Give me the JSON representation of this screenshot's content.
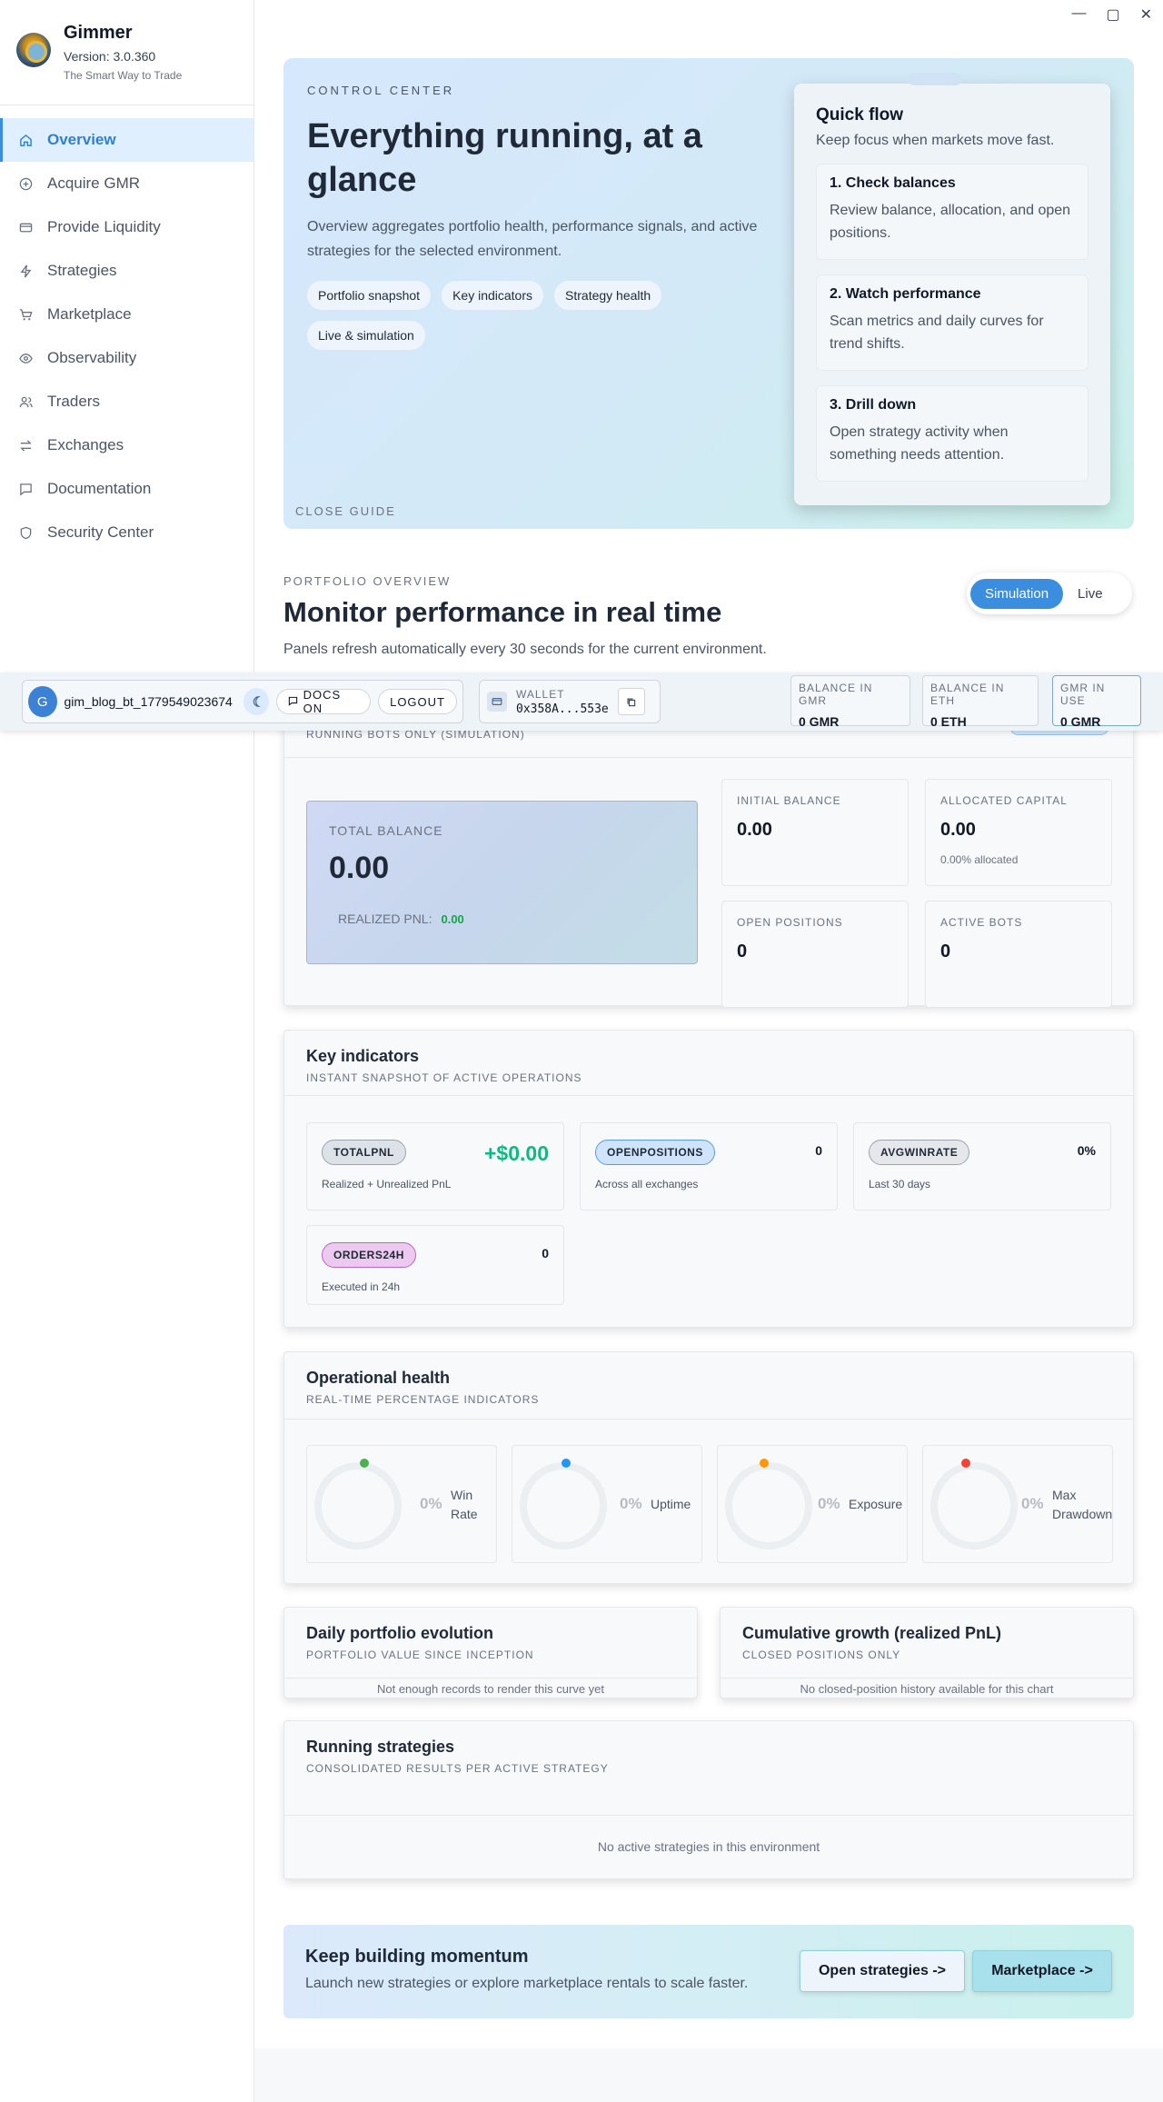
{
  "app": {
    "name": "Gimmer",
    "version": "Version: 3.0.360",
    "tagline": "The Smart Way to Trade"
  },
  "window_controls": {
    "minimize": "—",
    "maximize": "▢",
    "close": "✕"
  },
  "sidebar": {
    "items": [
      {
        "label": "Overview",
        "icon": "home-icon"
      },
      {
        "label": "Acquire GMR",
        "icon": "plus-circle-icon"
      },
      {
        "label": "Provide Liquidity",
        "icon": "card-icon"
      },
      {
        "label": "Strategies",
        "icon": "bolt-icon"
      },
      {
        "label": "Marketplace",
        "icon": "cart-icon"
      },
      {
        "label": "Observability",
        "icon": "eye-icon"
      },
      {
        "label": "Traders",
        "icon": "users-icon"
      },
      {
        "label": "Exchanges",
        "icon": "swap-icon"
      },
      {
        "label": "Documentation",
        "icon": "book-icon"
      },
      {
        "label": "Security Center",
        "icon": "shield-icon"
      }
    ]
  },
  "hero": {
    "kicker": "CONTROL CENTER",
    "title": "Everything running, at a glance",
    "description": "Overview aggregates portfolio health, performance signals, and active strategies for the selected environment.",
    "chips": [
      "Portfolio snapshot",
      "Key indicators",
      "Strategy health",
      "Live & simulation"
    ],
    "close_guide": "CLOSE GUIDE",
    "quick_flow": {
      "title": "Quick flow",
      "subtitle": "Keep focus when markets move fast.",
      "steps": [
        {
          "title": "1. Check balances",
          "text": "Review balance, allocation, and open positions."
        },
        {
          "title": "2. Watch performance",
          "text": "Scan metrics and daily curves for trend shifts."
        },
        {
          "title": "3. Drill down",
          "text": "Open strategy activity when something needs attention."
        }
      ]
    }
  },
  "portfolio_overview": {
    "kicker": "PORTFOLIO OVERVIEW",
    "title": "Monitor performance in real time",
    "description": "Panels refresh automatically every 30 seconds for the current environment.",
    "env_toggle": {
      "simulation": "Simulation",
      "live": "Live",
      "selected": "Simulation"
    }
  },
  "topbar": {
    "avatar_initial": "G",
    "username": "gim_blog_bt_1779549023674",
    "docs_label": "DOCS ON",
    "logout_label": "LOGOUT",
    "wallet_label": "WALLET",
    "wallet_address": "0x358A...553e",
    "balances": [
      {
        "label": "BALANCE IN GMR",
        "value": "0 GMR"
      },
      {
        "label": "BALANCE IN ETH",
        "value": "0 ETH"
      },
      {
        "label": "GMR IN USE",
        "value": "0 GMR"
      }
    ]
  },
  "balance_card": {
    "subtitle": "RUNNING BOTS ONLY (SIMULATION)",
    "total_label": "TOTAL BALANCE",
    "total_value": "0.00",
    "realized_label": "REALIZED PNL:",
    "realized_value": "0.00",
    "tiles": [
      {
        "label": "INITIAL BALANCE",
        "value": "0.00",
        "sub": ""
      },
      {
        "label": "ALLOCATED CAPITAL",
        "value": "0.00",
        "sub": "0.00% allocated"
      },
      {
        "label": "OPEN POSITIONS",
        "value": "0",
        "sub": ""
      },
      {
        "label": "ACTIVE BOTS",
        "value": "0",
        "sub": ""
      }
    ]
  },
  "key_indicators": {
    "title": "Key indicators",
    "subtitle": "INSTANT SNAPSHOT OF ACTIVE OPERATIONS",
    "items": [
      {
        "tag": "TOTALPNL",
        "value": "+$0.00",
        "desc": "Realized + Unrealized PnL",
        "color": "#dde2e8"
      },
      {
        "tag": "OPENPOSITIONS",
        "value": "0",
        "desc": "Across all exchanges",
        "color": "#cfe4fb"
      },
      {
        "tag": "AVGWINRATE",
        "value": "0%",
        "desc": "Last 30 days",
        "color": "#e5e7eb"
      },
      {
        "tag": "ORDERS24H",
        "value": "0",
        "desc": "Executed in 24h",
        "color": "#ecc9ee"
      }
    ]
  },
  "operational_health": {
    "title": "Operational health",
    "subtitle": "REAL-TIME PERCENTAGE INDICATORS",
    "gauges": [
      {
        "label": "Win Rate",
        "value": "0%",
        "color": "#4caf50"
      },
      {
        "label": "Uptime",
        "value": "0%",
        "color": "#2196f3"
      },
      {
        "label": "Exposure",
        "value": "0%",
        "color": "#ff9800"
      },
      {
        "label": "Max Drawdown",
        "value": "0%",
        "color": "#f44336"
      }
    ]
  },
  "daily_portfolio": {
    "title": "Daily portfolio evolution",
    "subtitle": "PORTFOLIO VALUE SINCE INCEPTION",
    "empty": "Not enough records to render this curve yet"
  },
  "cumulative_growth": {
    "title": "Cumulative growth (realized PnL)",
    "subtitle": "CLOSED POSITIONS ONLY",
    "empty": "No closed-position history available for this chart"
  },
  "running_strategies": {
    "title": "Running strategies",
    "subtitle": "CONSOLIDATED RESULTS PER ACTIVE STRATEGY",
    "empty": "No active strategies in this environment"
  },
  "cta": {
    "title": "Keep building momentum",
    "text": "Launch new strategies or explore marketplace rentals to scale faster.",
    "open_strategies": "Open strategies  ->",
    "marketplace": "Marketplace  ->"
  }
}
